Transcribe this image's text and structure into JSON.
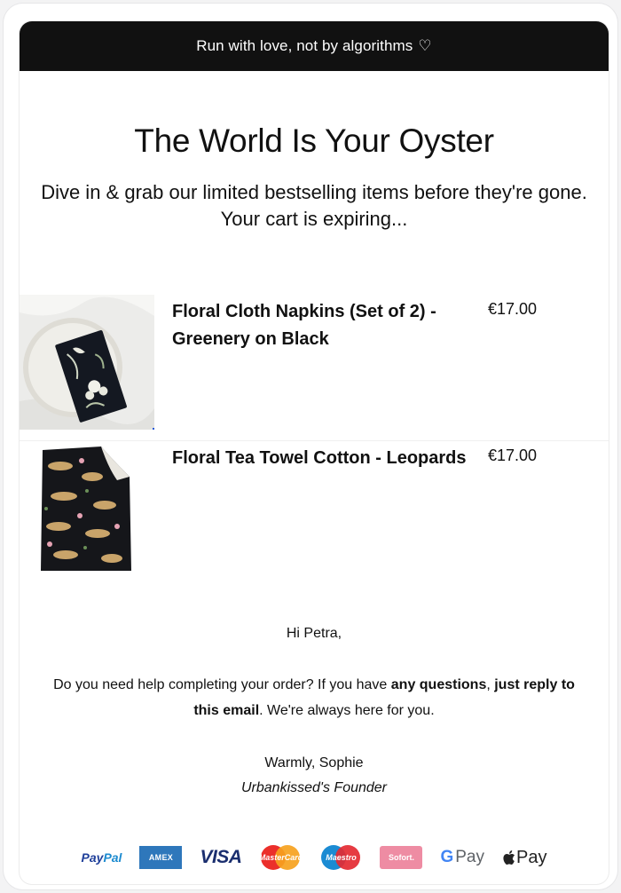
{
  "banner": {
    "text": "Run with love, not by algorithms",
    "heart": "♡"
  },
  "hero": {
    "title": "The World Is Your Oyster",
    "subtitle": "Dive in & grab our limited bestselling items before they're gone. Your cart is expiring..."
  },
  "products": [
    {
      "name": "Floral Cloth Napkins (Set of 2) - Greenery on Black",
      "price": "€17.00",
      "image": "floral-napkins-on-plate"
    },
    {
      "name": "Floral Tea Towel Cotton - Leopards",
      "price": "€17.00",
      "image": "leopard-tea-towel"
    }
  ],
  "greeting": "Hi Petra,",
  "message": {
    "part1": "Do you need help completing your order? If you have ",
    "bold1": "any questions",
    "part2": ", ",
    "bold2": "just reply to this email",
    "part3": ". We're always here for you."
  },
  "signoff": "Warmly, Sophie",
  "role": "Urbankissed's Founder",
  "payments": {
    "paypal_a": "Pay",
    "paypal_b": "Pal",
    "amex": "AMEX",
    "visa": "VISA",
    "mastercard": "MasterCard",
    "maestro": "Maestro",
    "sofort": "Sofort.",
    "gpay_g": "G",
    "gpay": "Pay",
    "apple_pay": "Pay"
  },
  "colors": {
    "banner_bg": "#111111",
    "paypal": "#1f3f9a",
    "amex": "#2e77bb",
    "visa": "#1a2e6e"
  }
}
